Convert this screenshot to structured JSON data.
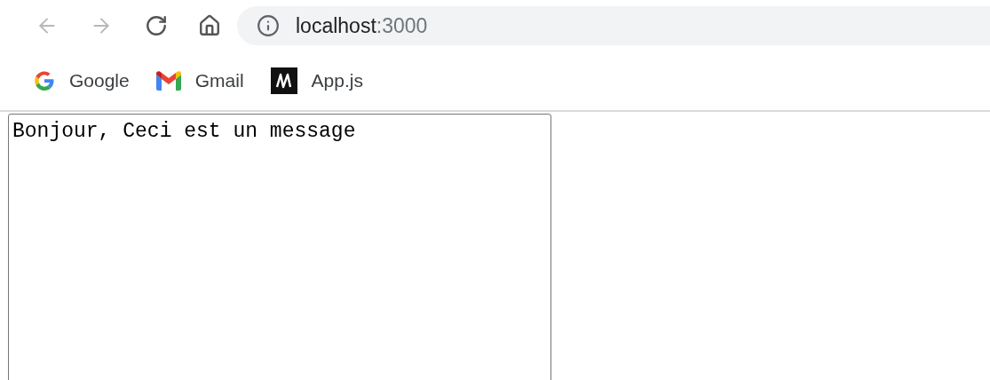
{
  "toolbar": {
    "back": {
      "disabled": true
    },
    "forward": {
      "disabled": true
    },
    "address": {
      "host": "localhost",
      "port": ":3000"
    }
  },
  "bookmarks": [
    {
      "label": "Google",
      "kind": "google"
    },
    {
      "label": "Gmail",
      "kind": "gmail"
    },
    {
      "label": "App.js",
      "kind": "app"
    }
  ],
  "page": {
    "message_box": {
      "value": "Bonjour, Ceci est un message"
    }
  }
}
